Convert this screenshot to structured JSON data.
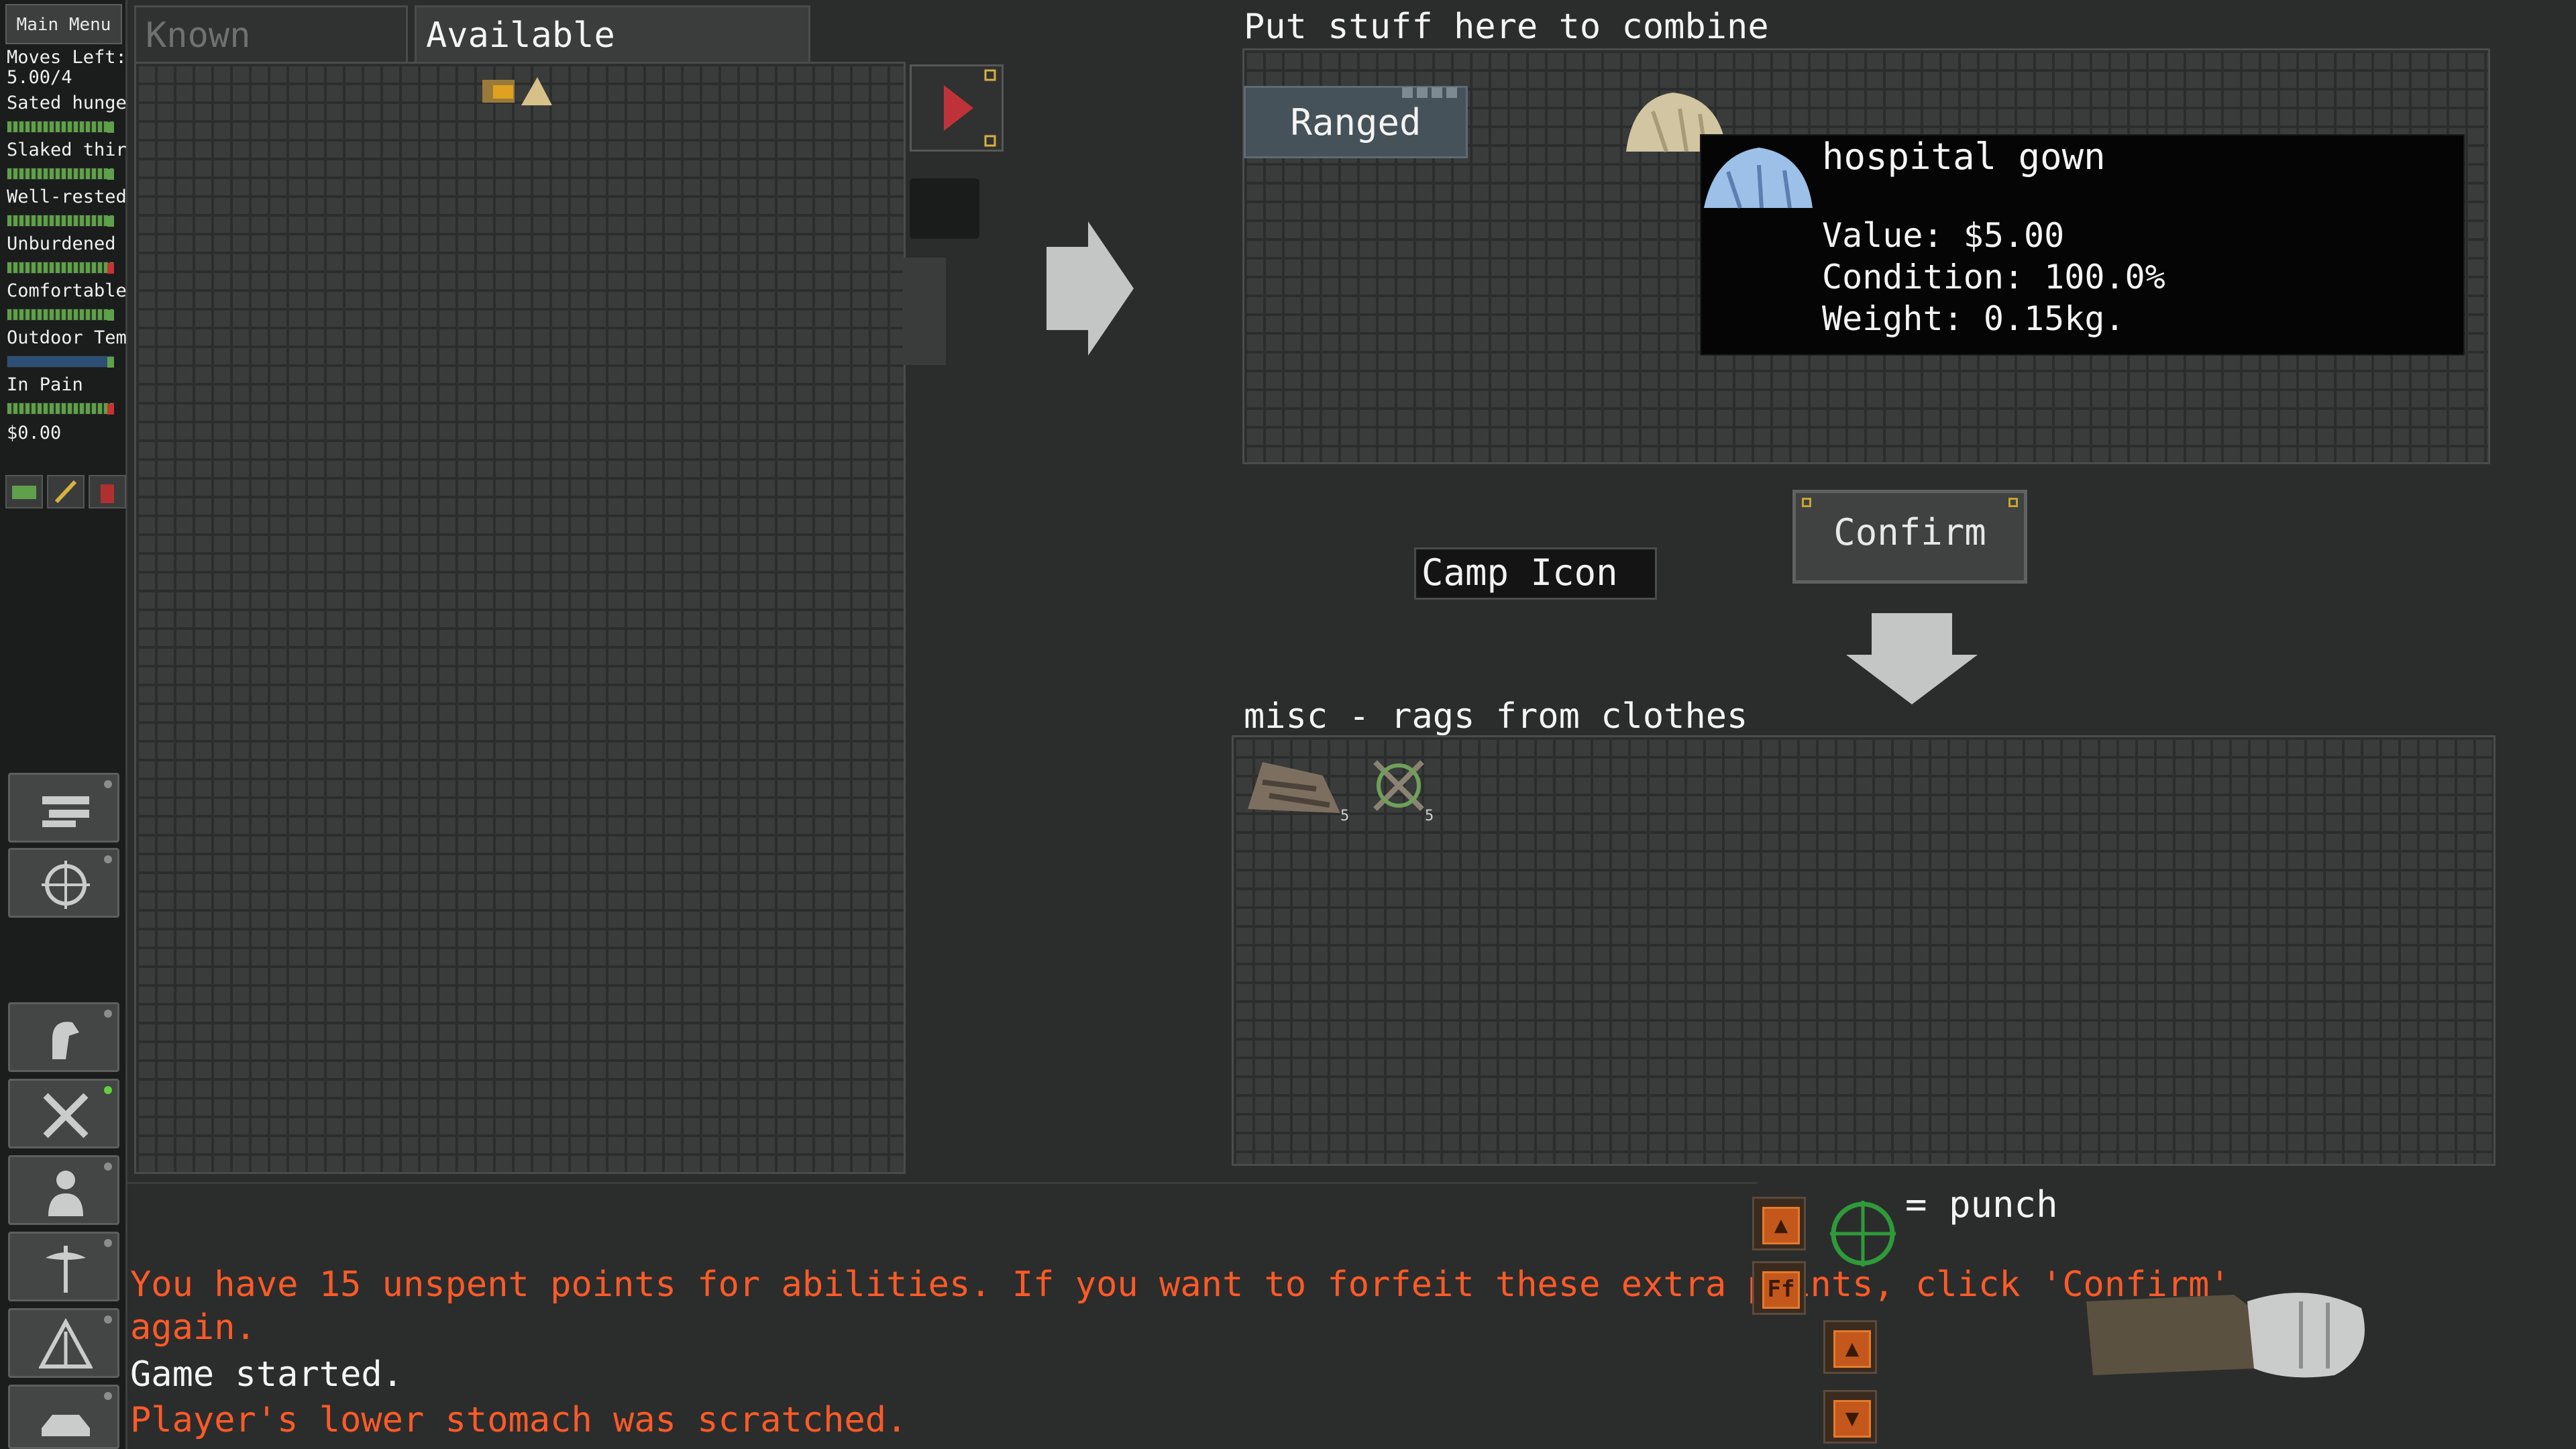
{
  "sidebar": {
    "main_menu": "Main Menu",
    "moves_label": "Moves Left:",
    "moves_value": "5.00/4",
    "stats": [
      {
        "label": "Sated hunge",
        "color": "#5fa04a"
      },
      {
        "label": "Slaked thirst",
        "color": "#5fa04a"
      },
      {
        "label": "Well-rested",
        "color": "#5fa04a"
      },
      {
        "label": "Unburdened",
        "color": "#c83232"
      },
      {
        "label": "Comfortable",
        "color": "#5fa04a"
      },
      {
        "label": "Outdoor Tem",
        "color": "#5fa04a"
      },
      {
        "label": "In Pain",
        "color": "#c83232"
      }
    ],
    "money": "$0.00"
  },
  "tabs": {
    "known_recipes": "Known Recipes",
    "available_ingredients": "Available Ingredients"
  },
  "combine": {
    "title": "Put stuff here to combine",
    "category_button": "Ranged"
  },
  "tooltip": {
    "name": "hospital gown",
    "value": "Value: $5.00",
    "condition": "Condition: 100.0%",
    "weight": "Weight: 0.15kg."
  },
  "confirm_label": "Confirm",
  "camp_icon_label": "Camp Icon",
  "result": {
    "title": "misc - rags from clothes",
    "items": [
      {
        "icon": "rags-icon",
        "qty": "5"
      },
      {
        "icon": "bandage-icon",
        "qty": "5"
      }
    ]
  },
  "attack": {
    "label": "= punch"
  },
  "log": {
    "lines": [
      {
        "text": "You have 15 unspent points for abilities. If you want to forfeit these extra points, click 'Confirm'",
        "color": "#ff5a28"
      },
      {
        "text": "again.",
        "color": "#ff5a28"
      },
      {
        "text": "Game started.",
        "color": "#f4f4f4"
      },
      {
        "text": "Player's lower stomach was scratched.",
        "color": "#ff5a28"
      }
    ]
  },
  "buttons": {
    "ff_label": "Ff"
  },
  "colors": {
    "accent_orange": "#c4571b",
    "warning_red": "#ff5a28",
    "play_red": "#c0323a"
  }
}
